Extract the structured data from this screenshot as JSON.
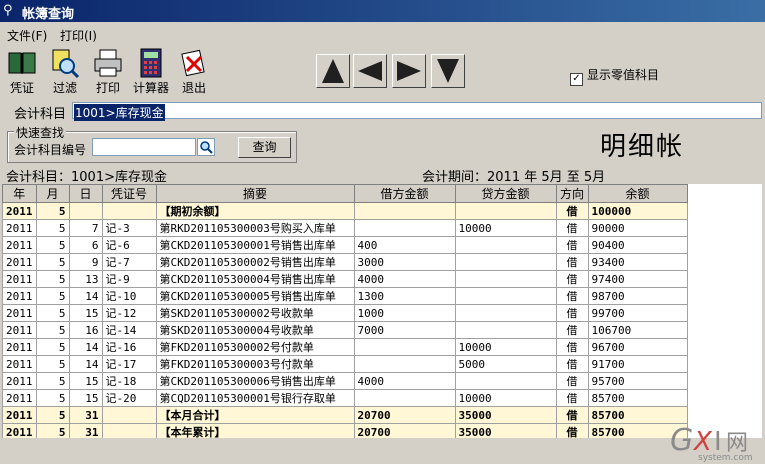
{
  "window": {
    "title": "帐簿查询"
  },
  "menu": [
    {
      "label": "文件(F)"
    },
    {
      "label": "打印(I)"
    }
  ],
  "toolbar": {
    "buttons": [
      {
        "label": "凭证",
        "icon": "book-icon"
      },
      {
        "label": "过滤",
        "icon": "filter-magnifier-icon"
      },
      {
        "label": "打印",
        "icon": "printer-icon"
      },
      {
        "label": "计算器",
        "icon": "calculator-icon"
      },
      {
        "label": "退出",
        "icon": "exit-icon"
      }
    ],
    "nav": [
      "first-icon",
      "prev-icon",
      "next-icon",
      "last-icon"
    ]
  },
  "show_zero": {
    "label": "显示零值科目",
    "checked": true
  },
  "account": {
    "label": "会计科目",
    "value": "1001>库存现金"
  },
  "quick_search": {
    "title": "快速查找",
    "label": "会计科目编号",
    "value": "",
    "button": "查询"
  },
  "report_title": "明细帐",
  "summary": {
    "account_text": "会计科目：1001>库存现金",
    "period_text": "会计期间：2011 年 5月 至 5月"
  },
  "table": {
    "columns": [
      "年",
      "月",
      "日",
      "凭证号",
      "摘要",
      "借方金额",
      "贷方金额",
      "方向",
      "余额"
    ],
    "rows": [
      {
        "hl": true,
        "cells": [
          "2011",
          "5",
          "",
          "",
          "【期初余额】",
          "",
          "",
          "借",
          "100000"
        ]
      },
      {
        "hl": false,
        "cells": [
          "2011",
          "5",
          "7",
          "记-3",
          "第RKD201105300003号购买入库单",
          "",
          "10000",
          "借",
          "90000"
        ]
      },
      {
        "hl": false,
        "cells": [
          "2011",
          "5",
          "6",
          "记-6",
          "第CKD201105300001号销售出库单",
          "400",
          "",
          "借",
          "90400"
        ]
      },
      {
        "hl": false,
        "cells": [
          "2011",
          "5",
          "9",
          "记-7",
          "第CKD201105300002号销售出库单",
          "3000",
          "",
          "借",
          "93400"
        ]
      },
      {
        "hl": false,
        "cells": [
          "2011",
          "5",
          "13",
          "记-9",
          "第CKD201105300004号销售出库单",
          "4000",
          "",
          "借",
          "97400"
        ]
      },
      {
        "hl": false,
        "cells": [
          "2011",
          "5",
          "14",
          "记-10",
          "第CKD201105300005号销售出库单",
          "1300",
          "",
          "借",
          "98700"
        ]
      },
      {
        "hl": false,
        "cells": [
          "2011",
          "5",
          "15",
          "记-12",
          "第SKD201105300002号收款单",
          "1000",
          "",
          "借",
          "99700"
        ]
      },
      {
        "hl": false,
        "cells": [
          "2011",
          "5",
          "16",
          "记-14",
          "第SKD201105300004号收款单",
          "7000",
          "",
          "借",
          "106700"
        ]
      },
      {
        "hl": false,
        "cells": [
          "2011",
          "5",
          "14",
          "记-16",
          "第FKD201105300002号付款单",
          "",
          "10000",
          "借",
          "96700"
        ]
      },
      {
        "hl": false,
        "cells": [
          "2011",
          "5",
          "14",
          "记-17",
          "第FKD201105300003号付款单",
          "",
          "5000",
          "借",
          "91700"
        ]
      },
      {
        "hl": false,
        "cells": [
          "2011",
          "5",
          "15",
          "记-18",
          "第CKD201105300006号销售出库单",
          "4000",
          "",
          "借",
          "95700"
        ]
      },
      {
        "hl": false,
        "cells": [
          "2011",
          "5",
          "15",
          "记-20",
          "第CQD201105300001号银行存取单",
          "",
          "10000",
          "借",
          "85700"
        ]
      },
      {
        "hl": true,
        "cells": [
          "2011",
          "5",
          "31",
          "",
          "【本月合计】",
          "20700",
          "35000",
          "借",
          "85700"
        ]
      },
      {
        "hl": true,
        "cells": [
          "2011",
          "5",
          "31",
          "",
          "【本年累计】",
          "20700",
          "35000",
          "借",
          "85700"
        ]
      }
    ]
  },
  "watermark": {
    "brand": "GXI网",
    "site": "system.com"
  }
}
